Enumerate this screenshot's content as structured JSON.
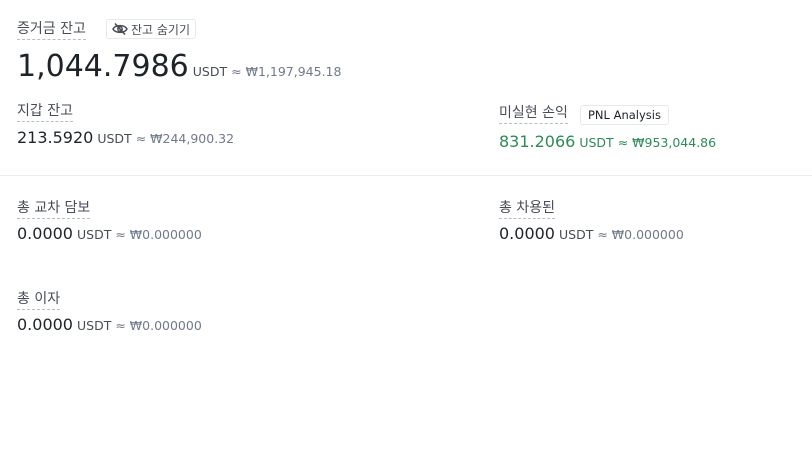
{
  "margin_balance": {
    "label": "증거금 잔고",
    "hide_button_label": "잔고 숨기기",
    "value": "1,044.7986",
    "unit": "USDT",
    "approx": "≈ ₩1,197,945.18"
  },
  "wallet_balance": {
    "label": "지갑 잔고",
    "value": "213.5920",
    "unit": "USDT",
    "approx": "≈ ₩244,900.32"
  },
  "unrealized_pnl": {
    "label": "미실현 손익",
    "button_label": "PNL Analysis",
    "value": "831.2066",
    "unit": "USDT",
    "approx": "≈ ₩953,044.86",
    "color": "#2e8b57"
  },
  "total_cross_collateral": {
    "label": "총 교차 담보",
    "value": "0.0000",
    "unit": "USDT",
    "approx": "≈ ₩0.000000"
  },
  "total_borrowed": {
    "label": "총 차용된",
    "value": "0.0000",
    "unit": "USDT",
    "approx": "≈ ₩0.000000"
  },
  "total_interest": {
    "label": "총 이자",
    "value": "0.0000",
    "unit": "USDT",
    "approx": "≈ ₩0.000000"
  },
  "icons": {
    "hide_icon": "eye-slash-icon"
  }
}
